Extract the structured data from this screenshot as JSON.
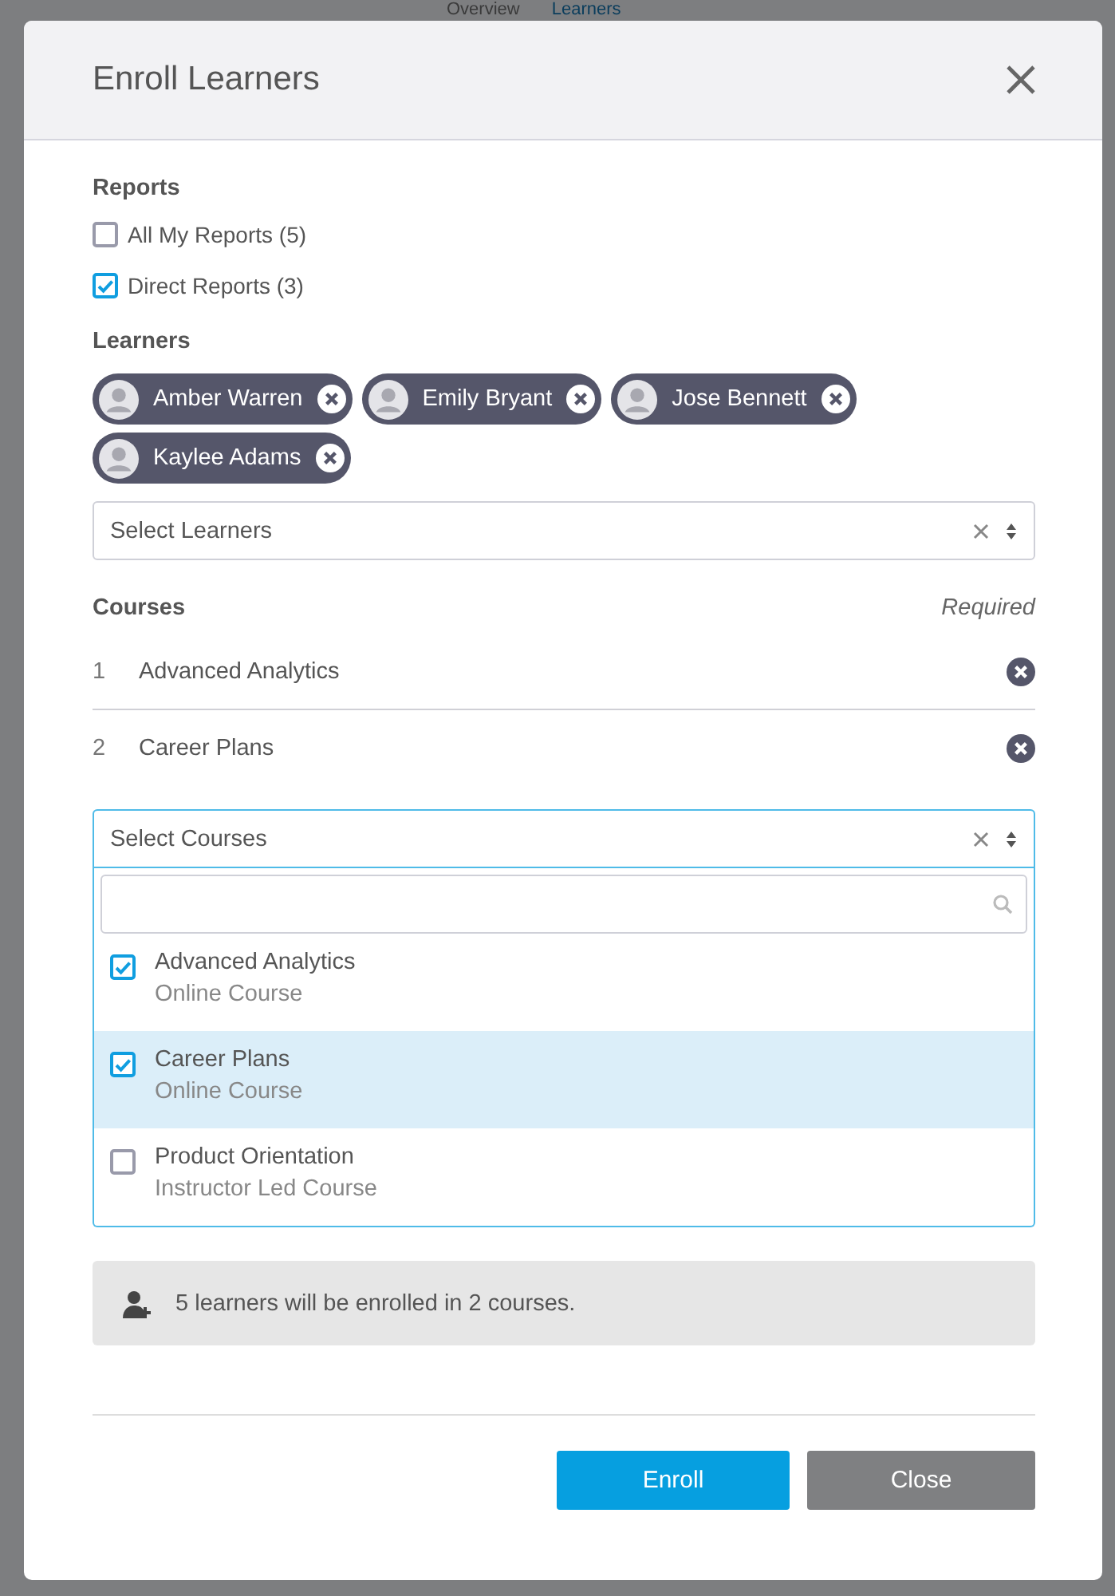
{
  "page_tabs": [
    {
      "label": "Overview",
      "selected": false
    },
    {
      "label": "Learners",
      "selected": true
    }
  ],
  "dialog": {
    "title": "Enroll Learners"
  },
  "reports": {
    "label": "Reports",
    "options": [
      {
        "label": "All My Reports (5)",
        "checked": false
      },
      {
        "label": "Direct Reports (3)",
        "checked": true
      }
    ]
  },
  "learners": {
    "label": "Learners",
    "chips": [
      "Amber Warren",
      "Emily Bryant",
      "Jose Bennett",
      "Kaylee Adams"
    ],
    "select": {
      "placeholder": "Select Learners"
    }
  },
  "courses": {
    "label": "Courses",
    "hint": "Required",
    "items": [
      {
        "number": "1",
        "name": "Advanced Analytics"
      },
      {
        "number": "2",
        "name": "Career Plans"
      }
    ],
    "select": {
      "placeholder": "Select Courses",
      "expanded": true
    },
    "options": [
      {
        "name": "Advanced Analytics",
        "type": "Online Course",
        "checked": true,
        "selected": false
      },
      {
        "name": "Career Plans",
        "type": "Online Course",
        "checked": true,
        "selected": true
      },
      {
        "name": "Product Orientation",
        "type": "Instructor Led Course",
        "checked": false,
        "selected": false
      }
    ]
  },
  "summary": "5 learners will be enrolled in 2 courses.",
  "buttons": [
    {
      "label": "Enroll",
      "kind": "primary"
    },
    {
      "label": "Close",
      "kind": "secondary"
    }
  ]
}
